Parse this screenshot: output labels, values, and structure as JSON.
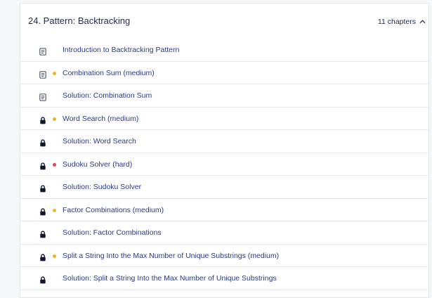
{
  "section": {
    "title": "24.  Pattern: Backtracking",
    "chapter_count": "11 chapters",
    "expanded": true
  },
  "colors": {
    "title": "#1e2a5a",
    "link": "#283a8a",
    "medium": "#f2b21b",
    "hard": "#e5484d"
  },
  "items": [
    {
      "label": "Introduction to Backtracking Pattern",
      "icon": "document-icon",
      "difficulty": ""
    },
    {
      "label": "Combination Sum (medium)",
      "icon": "document-icon",
      "difficulty": "medium"
    },
    {
      "label": "Solution: Combination Sum",
      "icon": "document-icon",
      "difficulty": ""
    },
    {
      "label": "Word Search (medium)",
      "icon": "lock-icon",
      "difficulty": "medium"
    },
    {
      "label": "Solution: Word Search",
      "icon": "lock-icon",
      "difficulty": ""
    },
    {
      "label": "Sudoku Solver (hard)",
      "icon": "lock-icon",
      "difficulty": "hard"
    },
    {
      "label": "Solution: Sudoku Solver",
      "icon": "lock-icon",
      "difficulty": ""
    },
    {
      "label": "Factor Combinations (medium)",
      "icon": "lock-icon",
      "difficulty": "medium"
    },
    {
      "label": "Solution: Factor Combinations",
      "icon": "lock-icon",
      "difficulty": ""
    },
    {
      "label": "Split a String Into the Max Number of Unique Substrings (medium)",
      "icon": "lock-icon",
      "difficulty": "medium"
    },
    {
      "label": "Solution: Split a String Into the Max Number of Unique Substrings",
      "icon": "lock-icon",
      "difficulty": ""
    }
  ]
}
